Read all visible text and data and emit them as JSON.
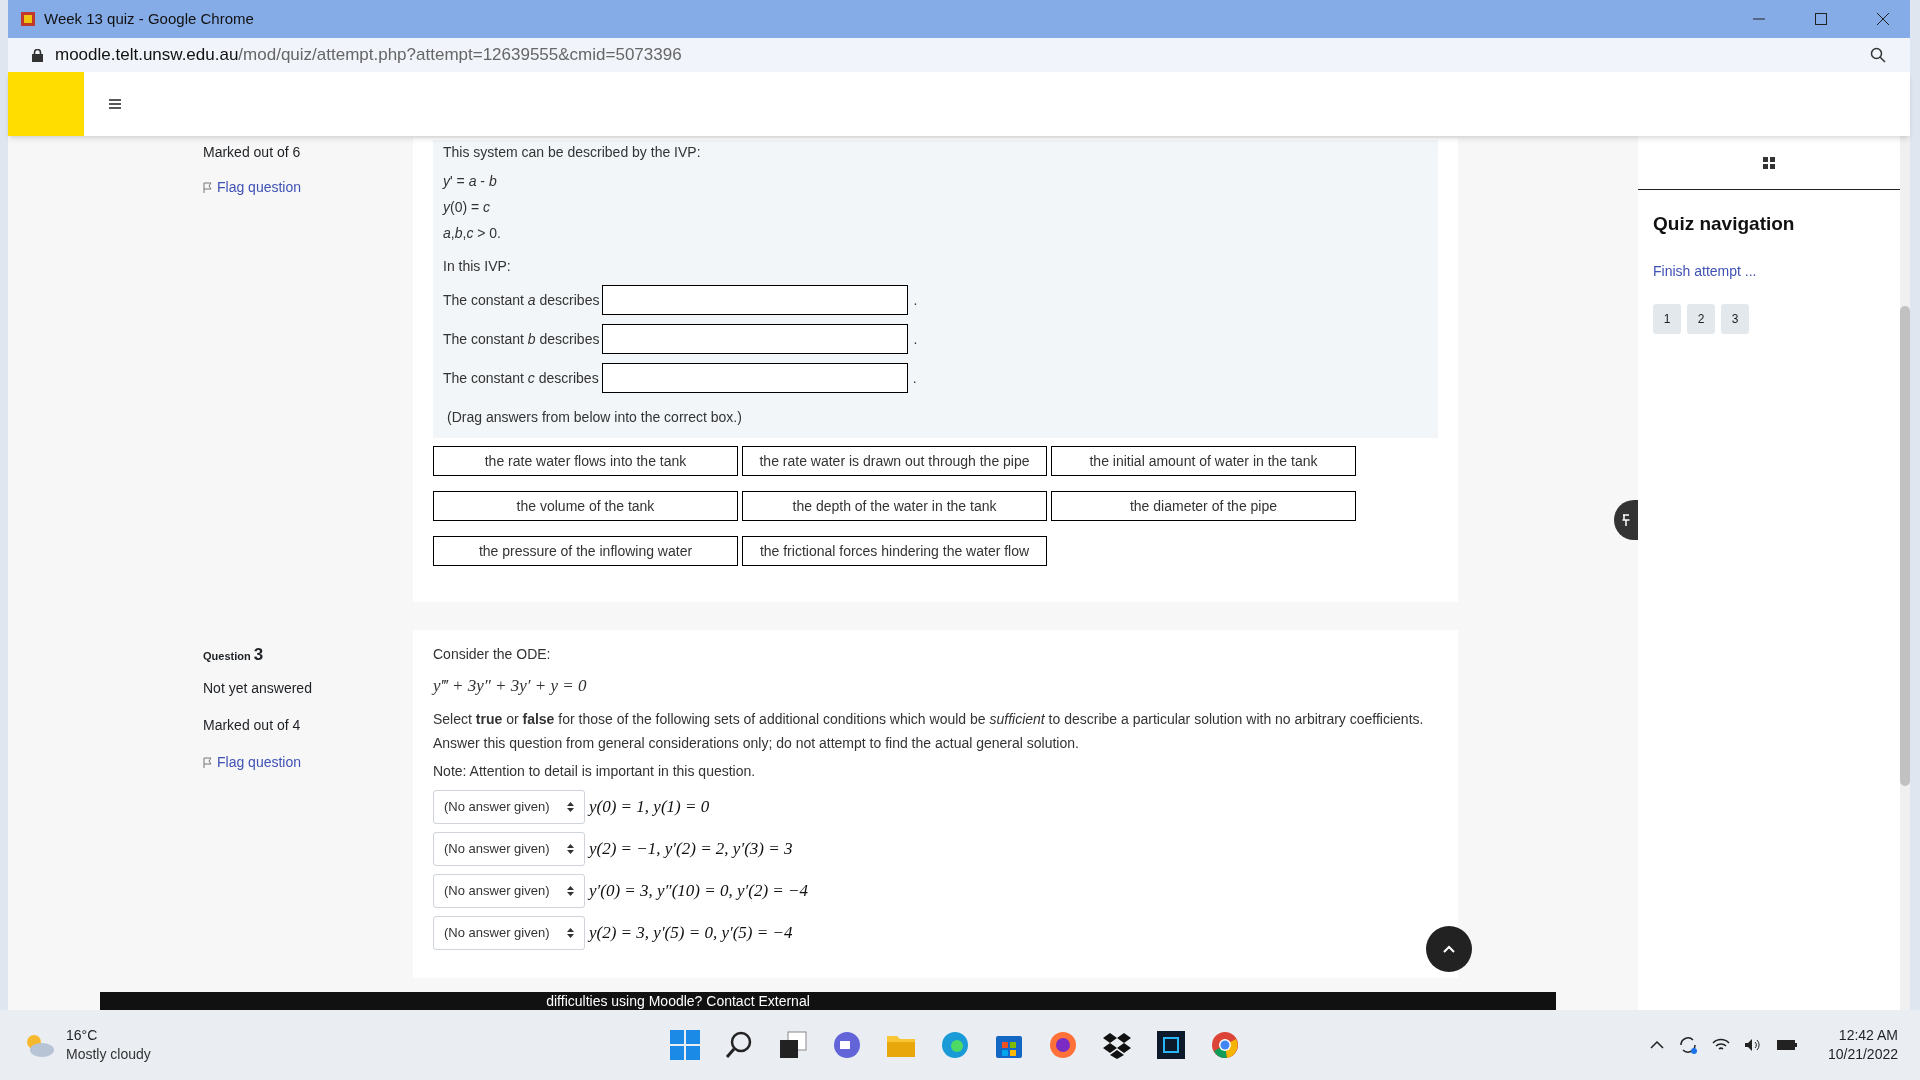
{
  "browser": {
    "title": "Week 13 quiz - Google Chrome",
    "url_host": "moodle.telt.unsw.edu.au",
    "url_path": "/mod/quiz/attempt.php?attempt=12639555&cmid=5073396"
  },
  "question2": {
    "marked": "Marked out of 6",
    "flag": "Flag question",
    "intro": "This system can be described by the IVP:",
    "ivp_lines": [
      "*y*' = *a* - *b*",
      "*y*(0) = *c*",
      "*a*,*b*,*c* > 0."
    ],
    "lead": "In this IVP:",
    "blanks": [
      {
        "label": "The constant *a* describes",
        "after": "."
      },
      {
        "label": "The constant *b* describes",
        "after": "."
      },
      {
        "label": "The constant *c* describes",
        "after": "."
      }
    ],
    "hint": "(Drag answers from below into the correct box.)",
    "choices": [
      "the rate water flows into the tank",
      "the rate water is drawn out through the pipe",
      "the initial amount of water in the tank",
      "the volume of the tank",
      "the depth of the water in the tank",
      "the diameter of the pipe",
      "the pressure of the inflowing water",
      "the frictional forces hindering the water flow"
    ]
  },
  "question3": {
    "label": "Question",
    "number": "3",
    "status": "Not yet answered",
    "marked": "Marked out of 4",
    "flag": "Flag question",
    "prompt": "Consider the ODE:",
    "equation": "y‴ + 3y″ + 3y′ + y = 0",
    "instructions": "Select **true** or **false** for those of the following sets of additional conditions which would be *sufficient* to describe a particular solution with no arbitrary coefficients.  Answer this question from general considerations only; do not attempt to find the actual general solution.",
    "note": "Note: Attention to detail is important in this question.",
    "conditions": [
      {
        "answer": "(No answer given)",
        "condition": "y(0) = 1, y(1) = 0"
      },
      {
        "answer": "(No answer given)",
        "condition": "y(2) = −1, y′(2) = 2, y′(3) = 3"
      },
      {
        "answer": "(No answer given)",
        "condition": "y′(0) = 3, y″(10) = 0, y′(2) = −4"
      },
      {
        "answer": "(No answer given)",
        "condition": "y(2) = 3, y′(5) = 0, y′(5) = −4"
      }
    ]
  },
  "quiz_navigation": {
    "title": "Quiz navigation",
    "finish": "Finish attempt ...",
    "questions": [
      "1",
      "2",
      "3"
    ]
  },
  "footer": {
    "text": "difficulties using Moodle? Contact External"
  },
  "taskbar": {
    "temperature": "16°C",
    "weather": "Mostly cloudy",
    "time": "12:42 AM",
    "date": "10/21/2022"
  }
}
